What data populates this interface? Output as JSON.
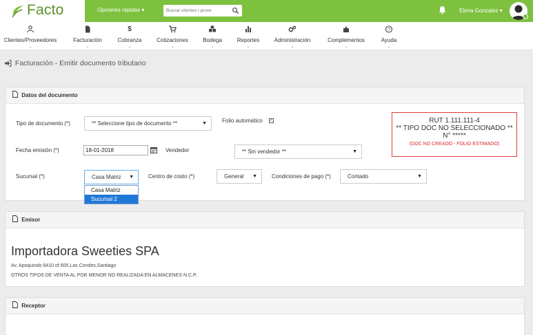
{
  "header": {
    "logo_text": "Facto",
    "quick_options": "Opciones rápidas ▾",
    "search_placeholder": "Buscar clientes / prove",
    "user_name": "Elena Gonzalez ▾"
  },
  "menu": [
    {
      "label": "Clientes/Proveedores",
      "icon": "users-icon",
      "glyph": "👥"
    },
    {
      "label": "Facturación",
      "icon": "file-icon",
      "glyph": "▮"
    },
    {
      "label": "Cobranza",
      "icon": "dollar-icon",
      "glyph": "$"
    },
    {
      "label": "Cotizaciones",
      "icon": "cart-icon",
      "glyph": "⛟"
    },
    {
      "label": "Bodega",
      "icon": "truck-icon",
      "glyph": "⚙"
    },
    {
      "label": "Reportes",
      "icon": "bar-chart-icon",
      "glyph": "▟"
    },
    {
      "label": "Administración",
      "icon": "cogs-icon",
      "glyph": "⚙"
    },
    {
      "label": "Complementos",
      "icon": "puzzle-icon",
      "glyph": "✚"
    },
    {
      "label": "Ayuda",
      "icon": "question-icon",
      "glyph": "?"
    }
  ],
  "breadcrumb": "Facturación - Emitir documento tributario",
  "documento": {
    "title": "Datos del documento",
    "tipo_label": "Tipo de documento (*)",
    "tipo_value": "** Seleccione tipo de documento **",
    "folio_label": "Folio automático",
    "fecha_label": "Fecha emisión (*)",
    "fecha_value": "18-01-2018",
    "vendedor_label": "Vendedor",
    "vendedor_value": "** Sin vendedor **",
    "sucursal_label": "Sucursal (*)",
    "sucursal_value": "Casa Matriz",
    "sucursal_options": [
      "Casa Matriz",
      "Sucursal 2"
    ],
    "centro_label": "Centro de costo (*)",
    "centro_value": "General",
    "condiciones_label": "Condiciones de pago (*)",
    "condiciones_value": "Contado"
  },
  "info_box": {
    "rut": "RUT 1.111.111-4",
    "tipo": "** TIPO DOC NO SELECCIONADO **",
    "numero": "N° *****",
    "warning": "(DOC NO CREADO - FOLIO ESTIMADO)"
  },
  "emisor": {
    "title": "Emisor",
    "name": "Importadora Sweeties SPA",
    "address": "Av. Apoquindo 6410 of 605,Las Condes,Santiago",
    "giro": "OTROS TIPOS DE VENTA AL POR MENOR NO REALIZADA EN ALMACENES N.C.P."
  },
  "receptor": {
    "title": "Receptor"
  },
  "colors": {
    "brand_green": "#7dc13f",
    "logo_green": "#5b8f2b",
    "alert_red": "#d9232a",
    "select_blue": "#1e78d6"
  }
}
